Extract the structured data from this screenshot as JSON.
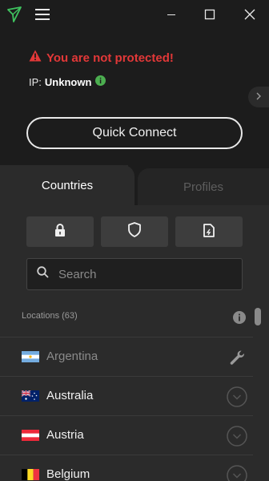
{
  "status": {
    "warning": "You are not protected!",
    "ip_label": "IP:",
    "ip_value": "Unknown"
  },
  "quick_connect": "Quick Connect",
  "tabs": {
    "countries": "Countries",
    "profiles": "Profiles"
  },
  "search": {
    "placeholder": "Search",
    "value": ""
  },
  "locations_header": "Locations (63)",
  "countries": [
    {
      "name": "Argentina",
      "state": "maintenance"
    },
    {
      "name": "Australia",
      "state": "expandable"
    },
    {
      "name": "Austria",
      "state": "expandable"
    },
    {
      "name": "Belgium",
      "state": "expandable"
    }
  ],
  "colors": {
    "warning": "#e33838",
    "info": "#4caf50",
    "background": "#1c1c1c",
    "panel": "#2b2b2b"
  },
  "icons": {
    "logo": "triangle-logo-icon",
    "menu": "hamburger-icon",
    "filters": [
      "lock-icon",
      "shield-icon",
      "sim-card-icon"
    ]
  }
}
